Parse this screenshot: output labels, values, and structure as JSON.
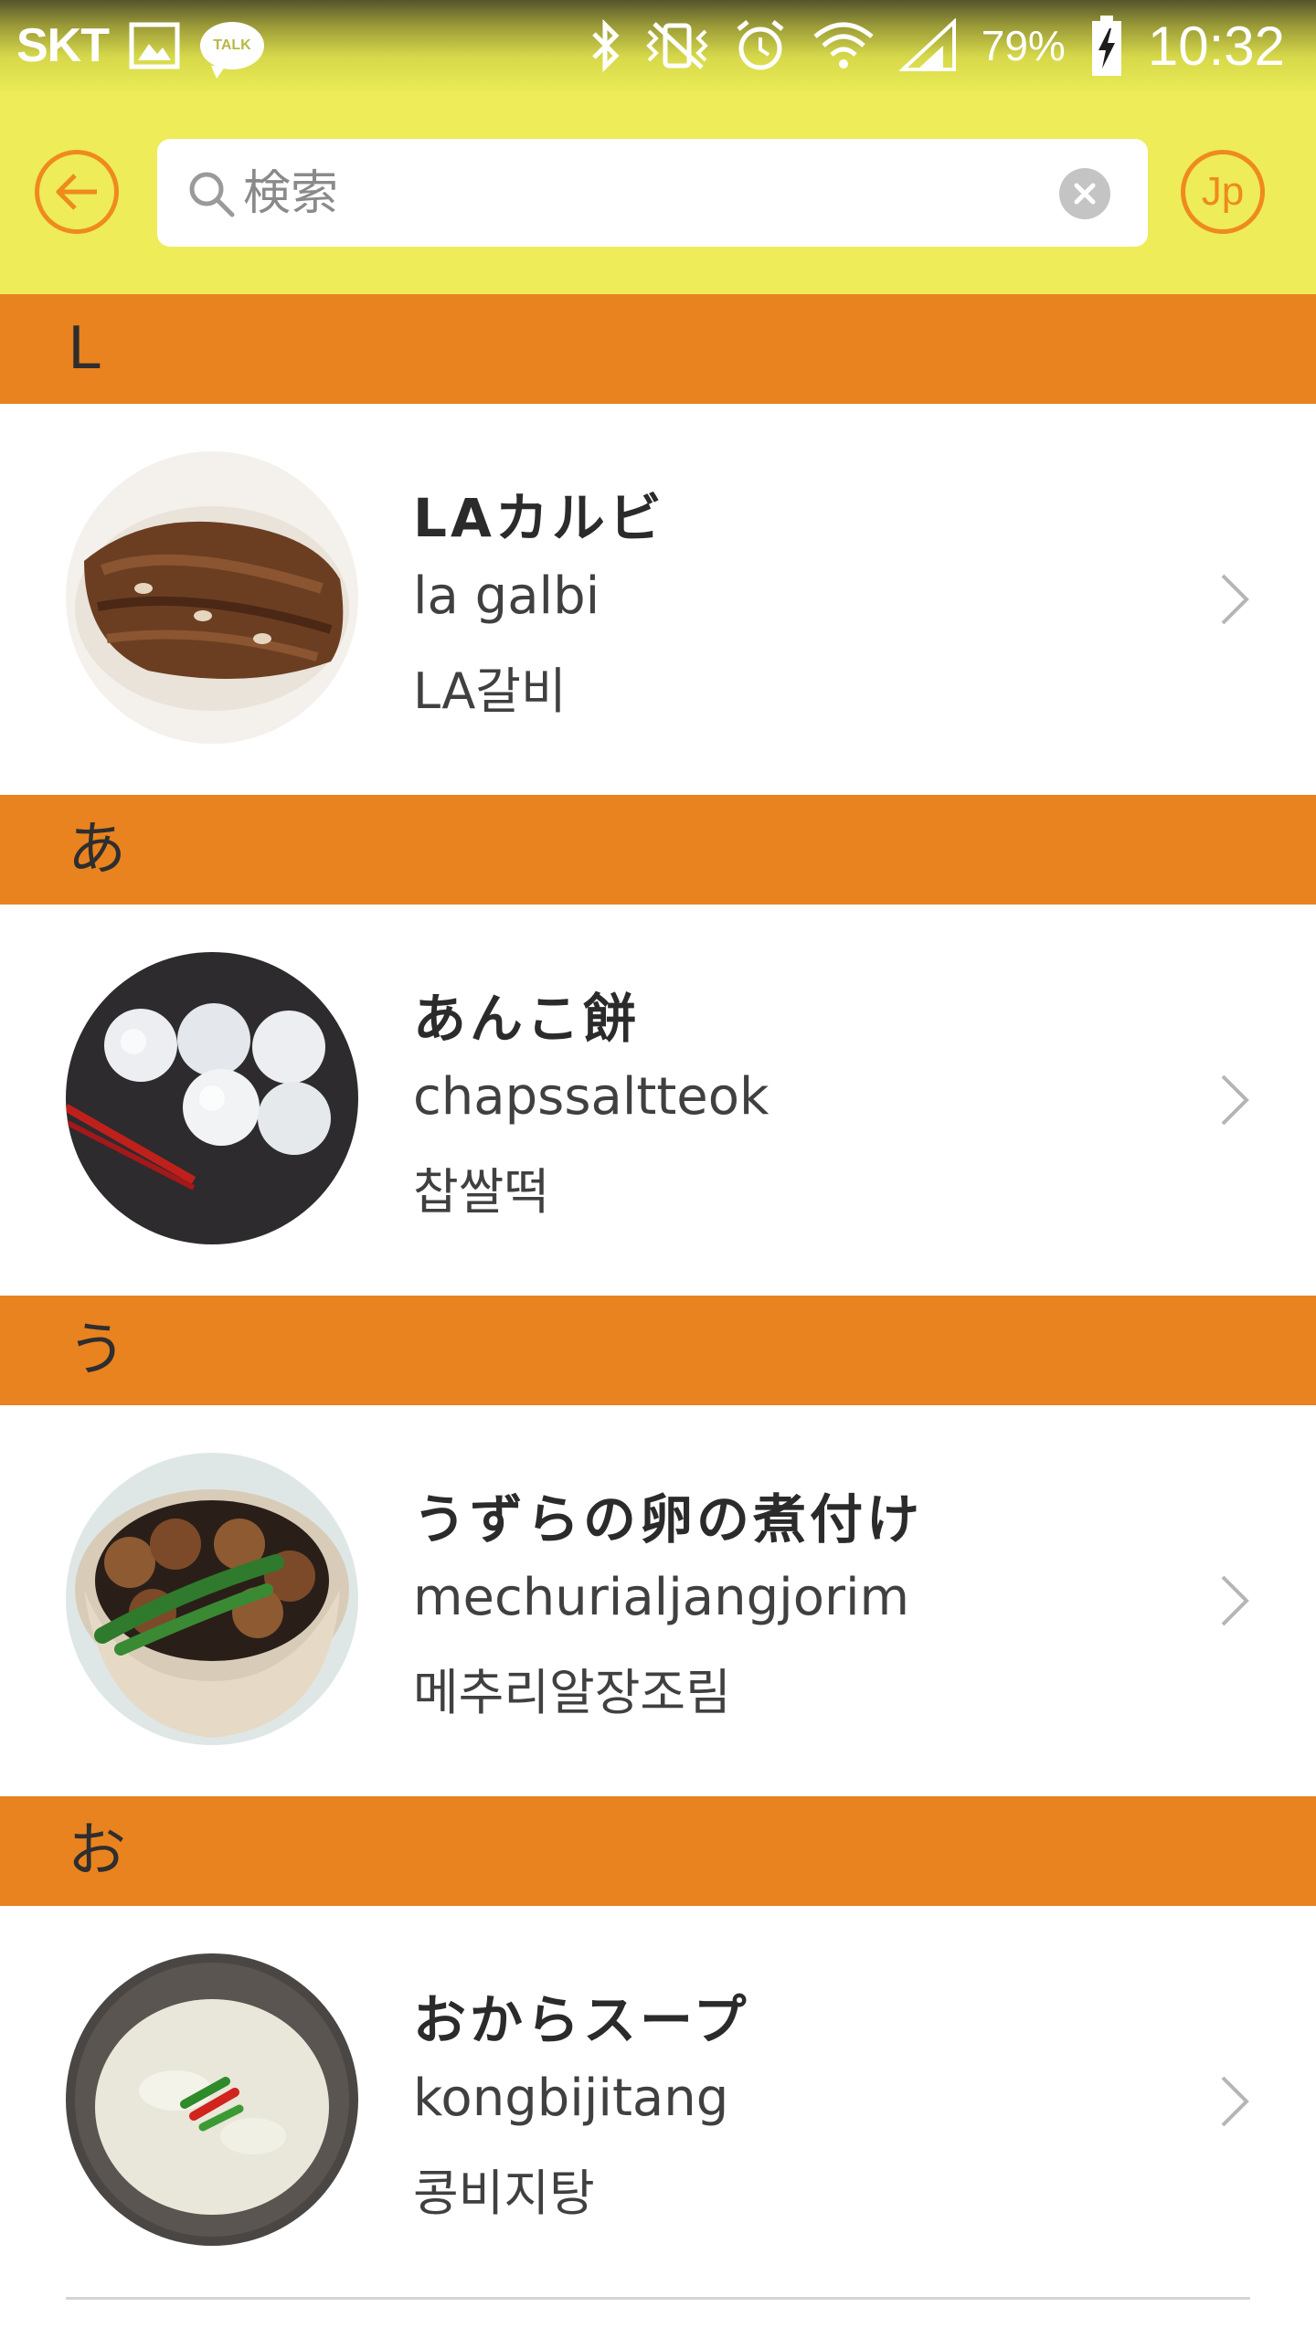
{
  "status_bar": {
    "carrier": "SKT",
    "talk_label": "TALK",
    "battery_percent": "79%",
    "time": "10:32",
    "icons": [
      "gallery-icon",
      "talk-icon",
      "bluetooth-icon",
      "vibrate-icon",
      "alarm-icon",
      "wifi-icon",
      "signal-icon",
      "battery-charging-icon"
    ]
  },
  "header": {
    "search_placeholder": "検索",
    "language_label": "Jp"
  },
  "colors": {
    "accent_yellow": "#eeec58",
    "section_orange": "#e9831f",
    "button_orange": "#ef8a1e"
  },
  "sections": [
    {
      "header": "L",
      "item": {
        "title": "LAカルビ",
        "romanization": "la galbi",
        "korean": "LA갈비",
        "image": "la-galbi-photo"
      }
    },
    {
      "header": "あ",
      "item": {
        "title": "あんこ餅",
        "romanization": "chapssaltteok",
        "korean": "찹쌀떡",
        "image": "chapssaltteok-photo"
      }
    },
    {
      "header": "う",
      "item": {
        "title": "うずらの卵の煮付け",
        "romanization": "mechurialjangjorim",
        "korean": "메추리알장조림",
        "image": "mechurialjangjorim-photo"
      }
    },
    {
      "header": "お",
      "item": {
        "title": "おからスープ",
        "romanization": "kongbijitang",
        "korean": "콩비지탕",
        "image": "kongbijitang-photo"
      }
    }
  ]
}
